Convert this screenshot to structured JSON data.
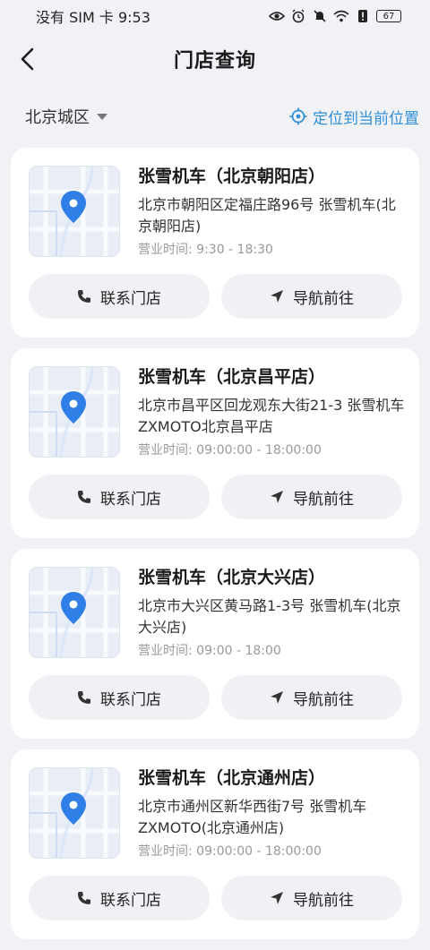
{
  "status_bar": {
    "carrier_time": "没有 SIM 卡 9:53",
    "battery": "67",
    "icons": [
      "eye-icon",
      "alarm-icon",
      "mute-icon",
      "wifi-icon",
      "alert-icon",
      "battery-icon"
    ]
  },
  "header": {
    "title": "门店查询",
    "back_icon": "chevron-left-icon"
  },
  "filter": {
    "city": "北京城区",
    "locate_label": "定位到当前位置"
  },
  "colors": {
    "accent": "#2f8fd8",
    "pin": "#2f7fe6",
    "background": "#f1f2f6"
  },
  "stores": [
    {
      "name": "张雪机车（北京朝阳店）",
      "address": "北京市朝阳区定福庄路96号 张雪机车(北京朝阳店)",
      "hours": "营业时间:  9:30 - 18:30",
      "contact_label": "联系门店",
      "navigate_label": "导航前往"
    },
    {
      "name": "张雪机车（北京昌平店）",
      "address": "北京市昌平区回龙观东大街21-3 张雪机车ZXMOTO北京昌平店",
      "hours": "营业时间:  09:00:00 - 18:00:00",
      "contact_label": "联系门店",
      "navigate_label": "导航前往"
    },
    {
      "name": "张雪机车（北京大兴店）",
      "address": "北京市大兴区黄马路1-3号 张雪机车(北京大兴店)",
      "hours": "营业时间:  09:00 - 18:00",
      "contact_label": "联系门店",
      "navigate_label": "导航前往"
    },
    {
      "name": "张雪机车（北京通州店）",
      "address": "北京市通州区新华西街7号 张雪机车ZXMOTO(北京通州店)",
      "hours": "营业时间:  09:00:00 - 18:00:00",
      "contact_label": "联系门店",
      "navigate_label": "导航前往"
    }
  ]
}
